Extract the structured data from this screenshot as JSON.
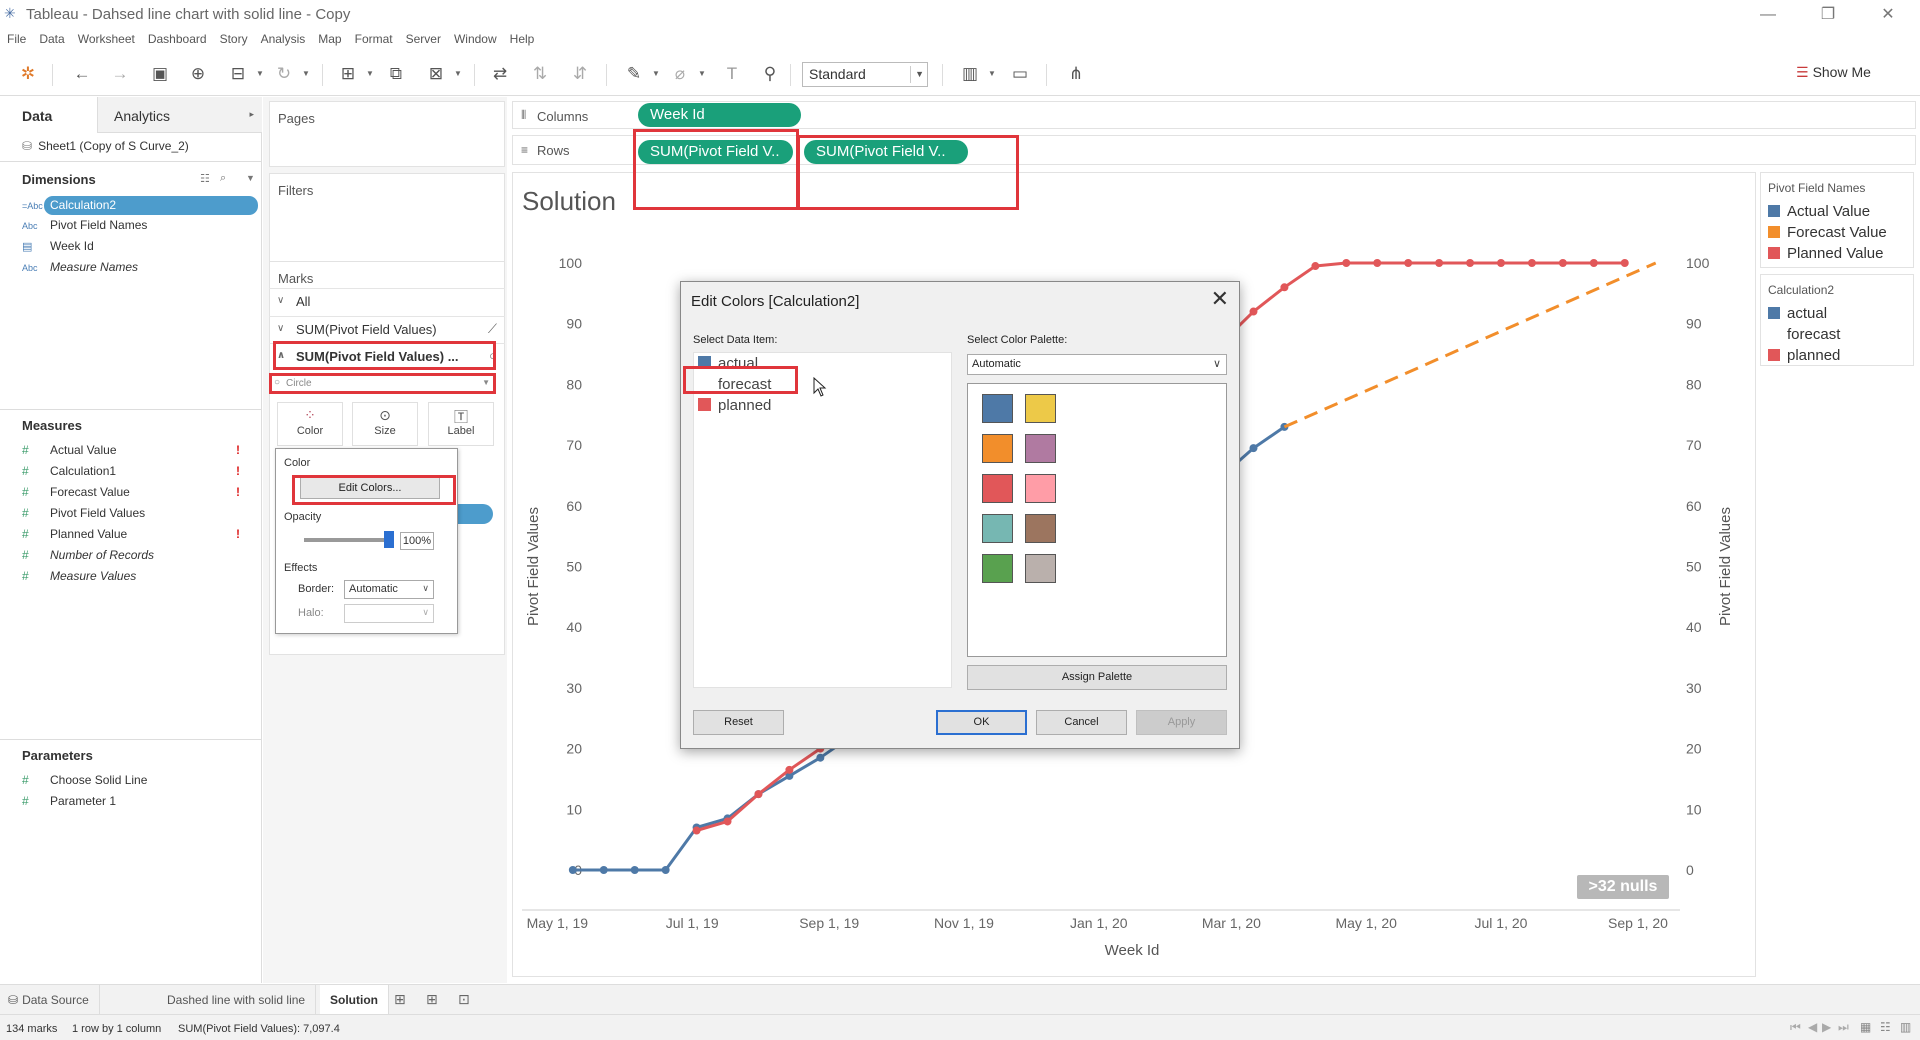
{
  "window": {
    "title": "Tableau - Dahsed line chart with solid line - Copy"
  },
  "menu": [
    "File",
    "Data",
    "Worksheet",
    "Dashboard",
    "Story",
    "Analysis",
    "Map",
    "Format",
    "Server",
    "Window",
    "Help"
  ],
  "toolbar": {
    "fit_select": "Standard",
    "show_me": "Show Me"
  },
  "left_pane": {
    "tabs": [
      "Data",
      "Analytics"
    ],
    "datasource": "Sheet1 (Copy of S Curve_2)",
    "dimensions_title": "Dimensions",
    "dimensions": [
      {
        "label": "Calculation2",
        "type": "=Abc"
      },
      {
        "label": "Pivot Field Names",
        "type": "Abc"
      },
      {
        "label": "Week Id",
        "type": "date"
      },
      {
        "label": "Measure Names",
        "type": "Abc"
      }
    ],
    "measures_title": "Measures",
    "measures": [
      {
        "label": "Actual Value",
        "warn": true
      },
      {
        "label": "Calculation1",
        "warn": true
      },
      {
        "label": "Forecast Value",
        "warn": true
      },
      {
        "label": "Pivot Field Values",
        "warn": false
      },
      {
        "label": "Planned Value",
        "warn": true
      },
      {
        "label": "Number of Records",
        "warn": false
      },
      {
        "label": "Measure Values",
        "warn": false
      }
    ],
    "parameters_title": "Parameters",
    "parameters": [
      "Choose Solid Line",
      "Parameter 1"
    ]
  },
  "cards": {
    "pages": "Pages",
    "filters": "Filters",
    "marks": "Marks",
    "marks_all": "All",
    "marks_row1": "SUM(Pivot Field Values)",
    "marks_row2": "SUM(Pivot Field Values) ...",
    "mark_type": "Circle",
    "buttons": [
      "Color",
      "Size",
      "Label"
    ]
  },
  "color_popup": {
    "title": "Color",
    "edit_colors": "Edit Colors...",
    "opacity_label": "Opacity",
    "opacity_value": "100%",
    "opacity": 1.0,
    "effects": "Effects",
    "border_label": "Border:",
    "border_value": "Automatic",
    "halo_label": "Halo:"
  },
  "shelves": {
    "columns": "Columns",
    "rows": "Rows",
    "columns_pill": "Week Id",
    "rows_pill1": "SUM(Pivot Field V..",
    "rows_pill2": "SUM(Pivot Field V.."
  },
  "view": {
    "title": "Solution",
    "nulls": ">32 nulls"
  },
  "legend_names": {
    "title": "Pivot Field Names",
    "items": [
      {
        "label": "Actual Value",
        "color": "#4e79a7"
      },
      {
        "label": "Forecast Value",
        "color": "#f28e2b"
      },
      {
        "label": "Planned Value",
        "color": "#e15759"
      }
    ]
  },
  "legend_calc": {
    "title": "Calculation2",
    "items": [
      {
        "label": "actual",
        "color": "#4e79a7"
      },
      {
        "label": "forecast",
        "color": null
      },
      {
        "label": "planned",
        "color": "#e15759"
      }
    ]
  },
  "dialog": {
    "title": "Edit Colors [Calculation2]",
    "select_item": "Select Data Item:",
    "select_palette": "Select Color Palette:",
    "palette": "Automatic",
    "items": [
      {
        "label": "actual",
        "color": "#4e79a7"
      },
      {
        "label": "forecast",
        "color": null
      },
      {
        "label": "planned",
        "color": "#e15759"
      }
    ],
    "swatches": [
      "#4e79a7",
      "#edc948",
      "#f28e2b",
      "#b07aa1",
      "#e15759",
      "#ff9da7",
      "#76b7b2",
      "#9c755f",
      "#59a14f",
      "#bab0ac"
    ],
    "assign_palette": "Assign Palette",
    "reset": "Reset",
    "ok": "OK",
    "cancel": "Cancel",
    "apply": "Apply"
  },
  "bottom_tabs": [
    "Data Source",
    "Dashed line with solid line",
    "Solution"
  ],
  "status": {
    "marks": "134 marks",
    "rows_cols": "1 row by 1 column",
    "sum": "SUM(Pivot Field Values): 7,097.4"
  },
  "chart_data": {
    "type": "line",
    "xlabel": "Week Id",
    "ylabel": "Pivot Field Values",
    "y2label": "Pivot Field Values",
    "ylim": [
      0,
      100
    ],
    "yticks": [
      0,
      10,
      20,
      30,
      40,
      50,
      60,
      70,
      80,
      90,
      100
    ],
    "xticks": [
      "May 1, 19",
      "Jul 1, 19",
      "Sep 1, 19",
      "Nov 1, 19",
      "Jan 1, 20",
      "Mar 1, 20",
      "May 1, 20",
      "Jul 1, 20",
      "Sep 1, 20"
    ],
    "xlim": [
      "2019-04-15",
      "2020-09-20"
    ],
    "series": [
      {
        "name": "actual",
        "color": "#4e79a7",
        "style": "solid",
        "points": [
          [
            "2019-05-08",
            0
          ],
          [
            "2019-05-22",
            0
          ],
          [
            "2019-06-05",
            0
          ],
          [
            "2019-06-19",
            0
          ],
          [
            "2019-07-03",
            7
          ],
          [
            "2019-07-17",
            8.5
          ],
          [
            "2019-07-31",
            12.5
          ],
          [
            "2019-08-14",
            15.5
          ],
          [
            "2019-08-28",
            18.5
          ],
          [
            "2020-02-12",
            61
          ],
          [
            "2020-02-26",
            65
          ],
          [
            "2020-03-11",
            69.5
          ],
          [
            "2020-03-25",
            73
          ]
        ]
      },
      {
        "name": "planned",
        "color": "#e15759",
        "style": "solid",
        "points": [
          [
            "2019-07-03",
            6.5
          ],
          [
            "2019-07-17",
            8
          ],
          [
            "2019-07-31",
            12.5
          ],
          [
            "2019-08-14",
            16.5
          ],
          [
            "2019-08-28",
            20
          ],
          [
            "2020-02-26",
            87
          ],
          [
            "2020-03-11",
            92
          ],
          [
            "2020-03-25",
            96
          ],
          [
            "2020-04-08",
            99.5
          ],
          [
            "2020-04-22",
            100
          ],
          [
            "2020-05-06",
            100
          ],
          [
            "2020-05-20",
            100
          ],
          [
            "2020-06-03",
            100
          ],
          [
            "2020-06-17",
            100
          ],
          [
            "2020-07-01",
            100
          ],
          [
            "2020-07-15",
            100
          ],
          [
            "2020-07-29",
            100
          ],
          [
            "2020-08-12",
            100
          ],
          [
            "2020-08-26",
            100
          ]
        ]
      },
      {
        "name": "forecast",
        "color": "#f28e2b",
        "style": "dashed",
        "points": [
          [
            "2020-03-25",
            73
          ],
          [
            "2020-09-09",
            100
          ]
        ]
      }
    ]
  }
}
